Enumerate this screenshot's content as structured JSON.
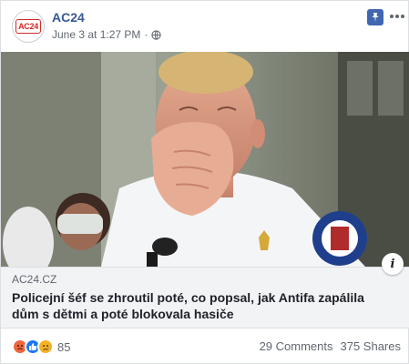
{
  "header": {
    "avatar_text": "AC24",
    "page_name": "AC24",
    "timestamp": "June 3 at 1:27 PM",
    "separator": "·",
    "privacy_icon": "globe-icon",
    "pin_icon": "pin-icon",
    "more_icon": "more-dots-icon"
  },
  "image": {
    "subject": "police-chief-press-photo"
  },
  "link_preview": {
    "domain": "AC24.CZ",
    "headline": "Policejní šéf se zhroutil poté, co popsal, jak Antifa zapálila dům s dětmi a poté blokovala hasiče",
    "info_icon": "i"
  },
  "footer": {
    "reaction_icons": [
      "angry-reaction-icon",
      "like-reaction-icon",
      "sad-reaction-icon"
    ],
    "reaction_count": "85",
    "comments": "29 Comments",
    "shares": "375 Shares"
  },
  "colors": {
    "brand_link": "#385898",
    "pin_blue": "#4267b2",
    "preview_bg": "#f2f3f5",
    "angry": "#f0663d",
    "like": "#1877f2",
    "sad": "#f7b125"
  }
}
